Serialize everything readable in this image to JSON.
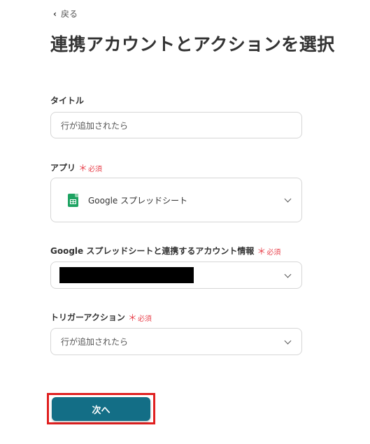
{
  "nav": {
    "back_label": "戻る"
  },
  "page": {
    "title": "連携アカウントとアクションを選択"
  },
  "form": {
    "title_label": "タイトル",
    "title_value": "行が追加されたら",
    "app_label": "アプリ",
    "required_text": "必須",
    "required_mark": "＊",
    "app_value": "Google スプレッドシート",
    "account_label": "Google スプレッドシートと連携するアカウント情報",
    "trigger_label": "トリガーアクション",
    "trigger_value": "行が追加されたら"
  },
  "actions": {
    "next_label": "次へ"
  },
  "icons": {
    "back": "chevron-left-icon",
    "app": "google-sheets-icon",
    "dropdown": "chevron-down-icon"
  },
  "colors": {
    "primary": "#136e86",
    "required": "#e8434d",
    "highlight": "#e02020",
    "sheets_green": "#1ea362"
  }
}
